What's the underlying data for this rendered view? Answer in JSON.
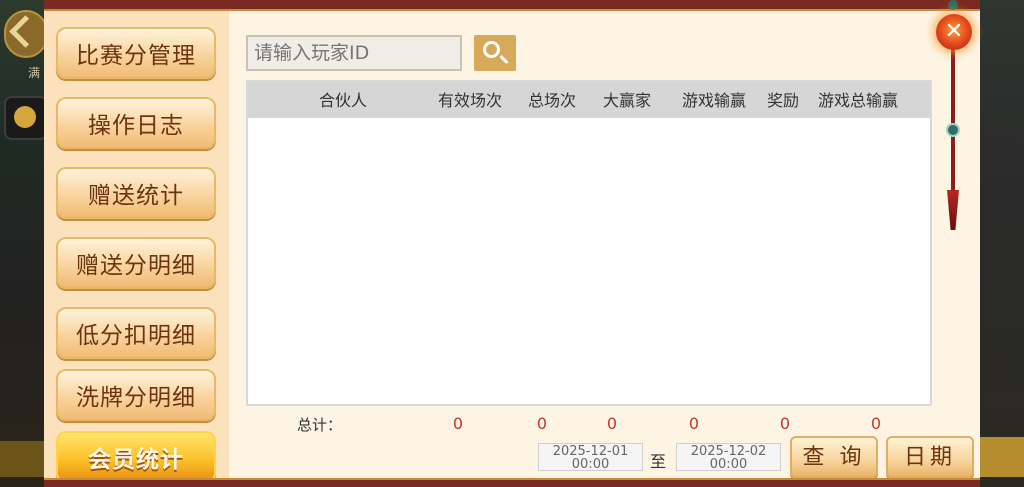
{
  "background": {
    "left_hint_text": "满"
  },
  "sidebar": {
    "items": [
      {
        "label": "比赛分管理",
        "active": false
      },
      {
        "label": "操作日志",
        "active": false
      },
      {
        "label": "赠送统计",
        "active": false
      },
      {
        "label": "赠送分明细",
        "active": false
      },
      {
        "label": "低分扣明细",
        "active": false
      },
      {
        "label": "洗牌分明细",
        "active": false
      },
      {
        "label": "会员统计",
        "active": true
      }
    ]
  },
  "search": {
    "placeholder": "请输入玩家ID",
    "value": ""
  },
  "table": {
    "columns": [
      "合伙人",
      "有效场次",
      "总场次",
      "大赢家",
      "游戏输赢",
      "奖励",
      "游戏总输赢"
    ],
    "rows": []
  },
  "totals": {
    "label": "总计：",
    "values": [
      "0",
      "0",
      "0",
      "0",
      "0",
      "0"
    ]
  },
  "date_range": {
    "start": {
      "date": "2025-12-01",
      "time": "00:00"
    },
    "separator": "至",
    "end": {
      "date": "2025-12-02",
      "time": "00:00"
    }
  },
  "buttons": {
    "query_label": "查 询",
    "date_label": "日期"
  },
  "colors": {
    "accent_gold": "#d7a95a",
    "total_value_red": "#c0392b",
    "active_nav": "#fbc22a",
    "frame_red": "#7a2a22"
  }
}
